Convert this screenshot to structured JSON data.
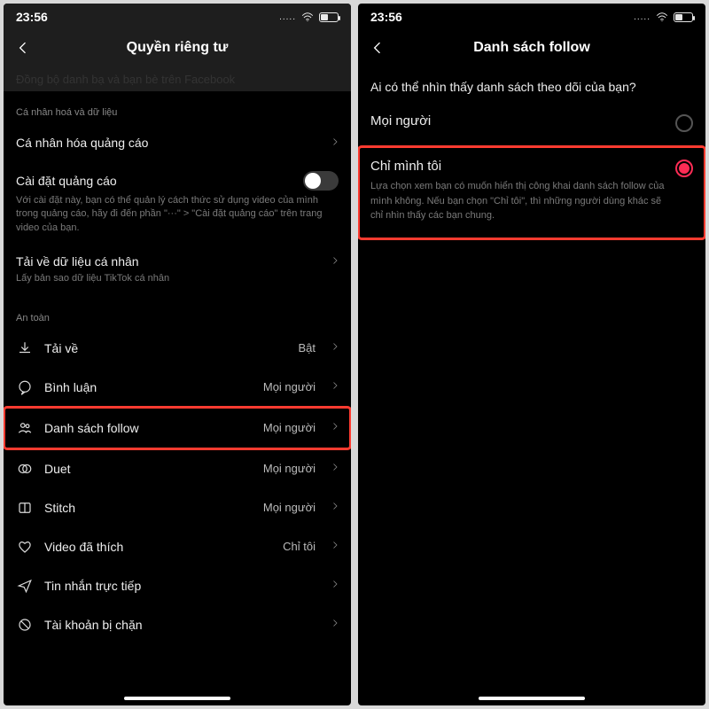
{
  "status": {
    "time": "23:56",
    "dots": "....."
  },
  "left": {
    "title": "Quyền riêng tư",
    "truncated_row": "Đồng bộ danh bạ và bạn bè trên Facebook",
    "section_personalize": "Cá nhân hoá và dữ liệu",
    "ad_personalization": "Cá nhân hóa quảng cáo",
    "ad_settings": {
      "label": "Cài đặt quảng cáo",
      "desc": "Với cài đặt này, bạn có thể quản lý cách thức sử dụng video của mình trong quảng cáo, hãy đi đến phần \"···\" > \"Cài đặt quảng cáo\" trên trang video của bạn."
    },
    "download_data": {
      "label": "Tải về dữ liệu cá nhân",
      "desc": "Lấy bản sao dữ liệu TikTok cá nhân"
    },
    "section_safety": "An toàn",
    "rows": {
      "download": {
        "label": "Tải về",
        "value": "Bật"
      },
      "comments": {
        "label": "Bình luận",
        "value": "Mọi người"
      },
      "followlist": {
        "label": "Danh sách follow",
        "value": "Mọi người"
      },
      "duet": {
        "label": "Duet",
        "value": "Mọi người"
      },
      "stitch": {
        "label": "Stitch",
        "value": "Mọi người"
      },
      "liked": {
        "label": "Video đã thích",
        "value": "Chỉ tôi"
      },
      "dm": {
        "label": "Tin nhắn trực tiếp",
        "value": ""
      },
      "blocked": {
        "label": "Tài khoản bị chặn",
        "value": ""
      }
    }
  },
  "right": {
    "title": "Danh sách follow",
    "question": "Ai có thể nhìn thấy danh sách theo dõi của bạn?",
    "options": {
      "everyone": {
        "name": "Mọi người"
      },
      "onlyme": {
        "name": "Chỉ mình tôi",
        "desc": "Lựa chọn xem bạn có muốn hiển thị công khai danh sách follow của mình không. Nếu bạn chọn \"Chỉ tôi\", thì những người dùng khác sẽ chỉ nhìn thấy các bạn chung."
      }
    }
  }
}
